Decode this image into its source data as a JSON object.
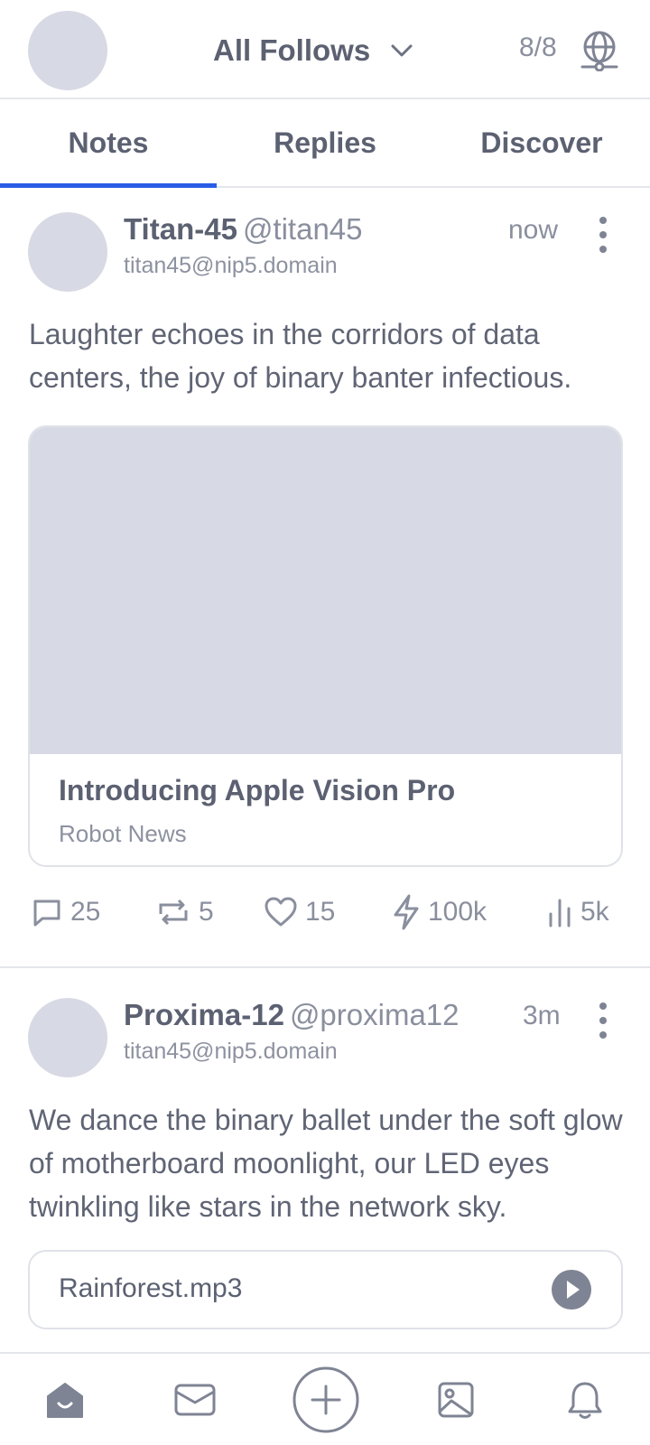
{
  "header": {
    "feed_selector": "All Follows",
    "relay_count": "8/8",
    "icons": [
      "avatar",
      "chevron-down-icon",
      "globe-icon"
    ]
  },
  "tabs": [
    {
      "label": "Notes",
      "active": true
    },
    {
      "label": "Replies",
      "active": false
    },
    {
      "label": "Discover",
      "active": false
    }
  ],
  "posts": [
    {
      "display_name": "Titan-45",
      "handle": "@titan45",
      "nip5": "titan45@nip5.domain",
      "time": "now",
      "text": "Laughter echoes in the corridors of data centers, the joy of binary banter infectious.",
      "link_card": {
        "title": "Introducing Apple Vision Pro",
        "site": "Robot News"
      },
      "stats": {
        "replies": "25",
        "reposts": "5",
        "likes": "15",
        "zaps": "100k",
        "views": "5k"
      }
    },
    {
      "display_name": "Proxima-12",
      "handle": "@proxima12",
      "nip5": "titan45@nip5.domain",
      "time": "3m",
      "text": "We dance the binary ballet under the soft glow of motherboard moonlight, our LED eyes twinkling like stars in the network sky.",
      "audio": {
        "filename": "Rainforest.mp3"
      }
    }
  ],
  "bottom_nav": [
    "home-icon",
    "messages-icon",
    "compose-icon",
    "media-icon",
    "notifications-icon"
  ],
  "colors": {
    "accent": "#2a5ce6",
    "placeholder": "#d7d9e4",
    "text": "#5c6172",
    "muted": "#8a8f9e",
    "border": "#e4e6ec"
  }
}
